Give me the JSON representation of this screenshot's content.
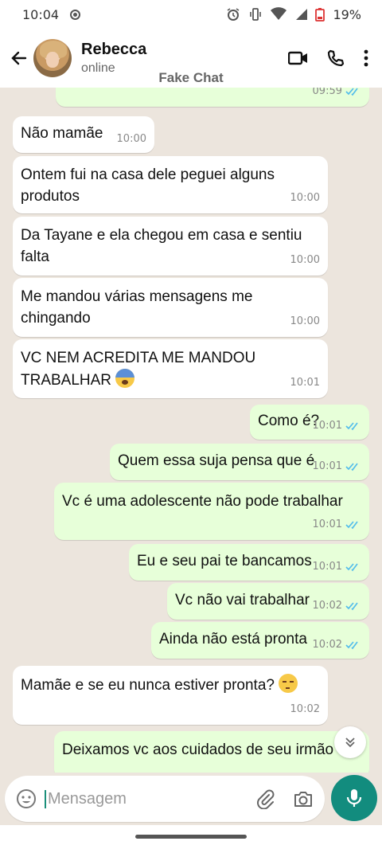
{
  "status_bar": {
    "time": "10:04",
    "battery": "19%"
  },
  "header": {
    "contact_name": "Rebecca",
    "contact_status": "online",
    "watermark": "Fake Chat"
  },
  "messages": [
    {
      "dir": "out",
      "text": "",
      "time": "09:59"
    },
    {
      "dir": "in",
      "text": "Não mamãe",
      "time": "10:00"
    },
    {
      "dir": "in",
      "text": "Ontem fui na casa dele peguei alguns produtos",
      "time": "10:00"
    },
    {
      "dir": "in",
      "text": "Da Tayane e ela chegou em casa e sentiu falta",
      "time": "10:00"
    },
    {
      "dir": "in",
      "text": "Me mandou várias mensagens me chingando",
      "time": "10:00"
    },
    {
      "dir": "in",
      "text": "VC NEM ACREDITA ME MANDOU TRABALHAR",
      "emoji": "fearful-face-emoji",
      "time": "10:01"
    },
    {
      "dir": "out",
      "text": "Como é?",
      "time": "10:01"
    },
    {
      "dir": "out",
      "text": "Quem essa suja pensa que é",
      "time": "10:01"
    },
    {
      "dir": "out",
      "text": "Vc é uma adolescente não pode trabalhar",
      "time": "10:01"
    },
    {
      "dir": "out",
      "text": "Eu e seu pai te bancamos",
      "time": "10:01"
    },
    {
      "dir": "out",
      "text": "Vc não vai trabalhar",
      "time": "10:02"
    },
    {
      "dir": "out",
      "text": "Ainda não está pronta",
      "time": "10:02"
    },
    {
      "dir": "in",
      "text": "Mamãe e se eu nunca estiver pronta?",
      "emoji": "pensive-face-emoji",
      "time": "10:02"
    },
    {
      "dir": "out",
      "text": "Deixamos vc aos cuidados de seu irmão",
      "time": ""
    }
  ],
  "input": {
    "placeholder": "Mensagem",
    "value": ""
  },
  "colors": {
    "incoming_bubble": "#ffffff",
    "outgoing_bubble": "#e7ffd9",
    "accent": "#128c7e",
    "read_ticks": "#53bdeb",
    "chat_background": "#ece5dd"
  }
}
